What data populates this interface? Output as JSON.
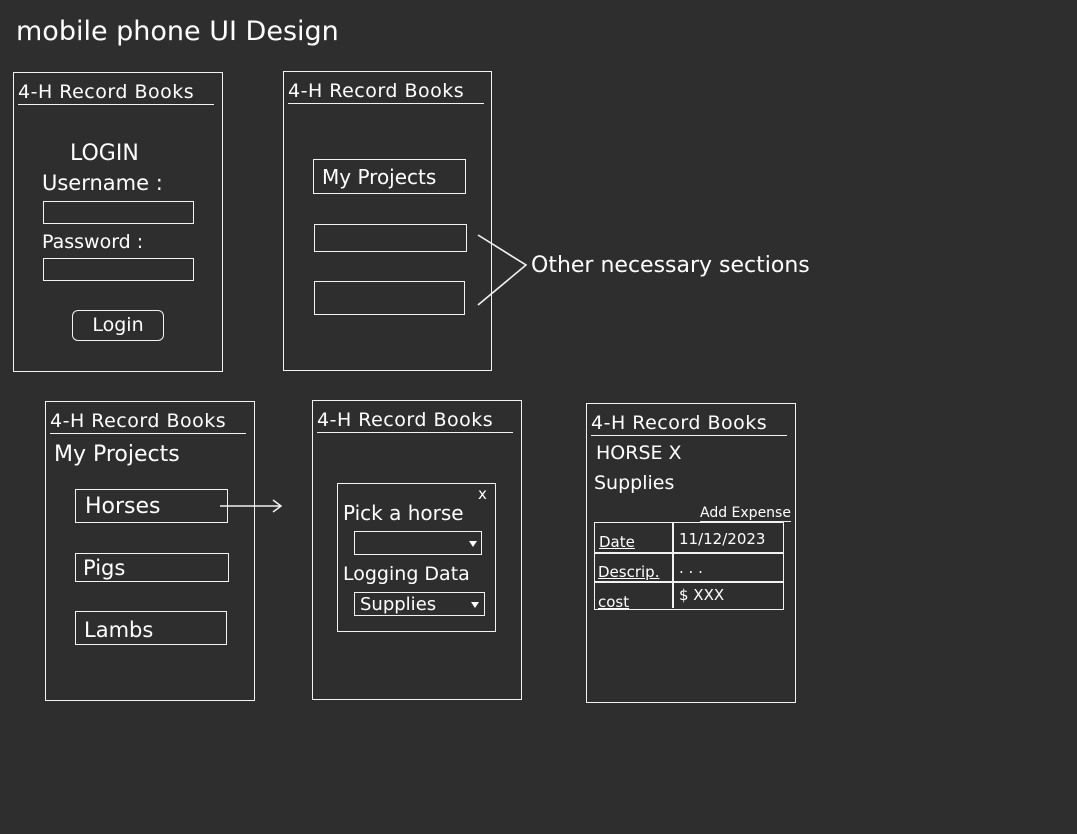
{
  "title": "mobile phone UI Design",
  "app_title": "4-H Record Books",
  "login_screen": {
    "heading": "LOGIN",
    "username_label": "Username :",
    "password_label": "Password :",
    "login_button": "Login"
  },
  "home_screen": {
    "my_projects_button": "My Projects",
    "annotation": "Other necessary sections"
  },
  "projects_screen": {
    "heading": "My Projects",
    "items": [
      "Horses",
      "Pigs",
      "Lambs"
    ]
  },
  "picker_screen": {
    "close": "x",
    "pick_label": "Pick a horse",
    "logging_label": "Logging Data",
    "logging_value": "Supplies"
  },
  "detail_screen": {
    "heading": "HORSE X",
    "subheading": "Supplies",
    "add_expense": "Add Expense",
    "rows": [
      {
        "label": "Date",
        "value": "11/12/2023"
      },
      {
        "label": "Descrip.",
        "value": ". . ."
      },
      {
        "label": "cost",
        "value": "$ XXX"
      }
    ]
  }
}
